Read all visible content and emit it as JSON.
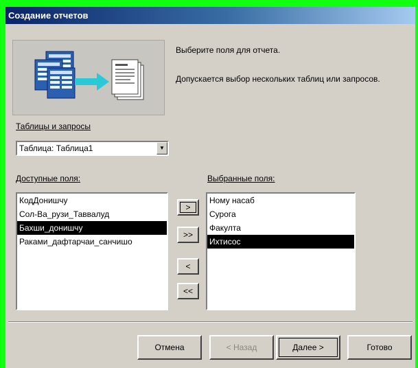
{
  "window": {
    "title": "Создание отчетов"
  },
  "instructions": {
    "line1": "Выберите поля для отчета.",
    "line2": "Допускается выбор нескольких таблиц или запросов."
  },
  "tables": {
    "label": "Таблицы и запросы",
    "selected": "Таблица: Таблица1"
  },
  "available": {
    "label": "Доступные поля:",
    "items": [
      {
        "text": "КодДонишчу",
        "selected": false
      },
      {
        "text": "Сол-Ва_рузи_Таввалуд",
        "selected": false
      },
      {
        "text": "Бахши_донишчу",
        "selected": true
      },
      {
        "text": "Раками_дафтарчаи_санчишо",
        "selected": false
      }
    ]
  },
  "selected_fields": {
    "label": "Выбранные поля:",
    "items": [
      {
        "text": "Ному насаб",
        "selected": false
      },
      {
        "text": "Сурога",
        "selected": false
      },
      {
        "text": "Факулта",
        "selected": false
      },
      {
        "text": "Ихтисос",
        "selected": true
      }
    ]
  },
  "move_buttons": {
    "add_one": ">",
    "add_all": ">>",
    "remove_one": "<",
    "remove_all": "<<"
  },
  "footer": {
    "cancel": "Отмена",
    "back": "< Назад",
    "next": "Далее >",
    "finish": "Готово"
  }
}
